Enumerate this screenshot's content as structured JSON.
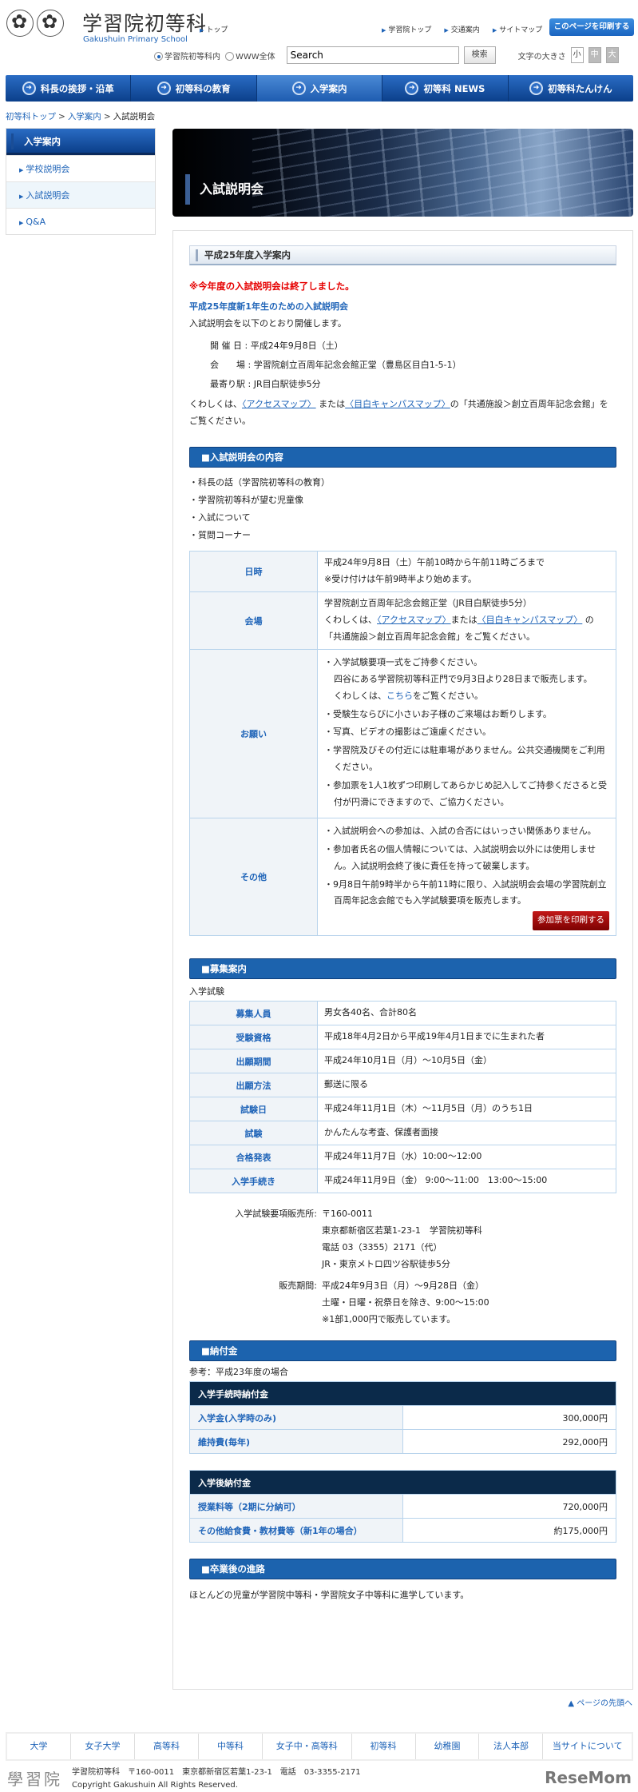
{
  "header": {
    "title": "学習院初等科",
    "subtitle": "Gakushuin Primary School",
    "top_link": "トップ",
    "util_links": [
      "学習院トップ",
      "交通案内",
      "サイトマップ"
    ],
    "print_label": "このページを印刷する",
    "search": {
      "scope_options": [
        "学習院初等科内",
        "WWW全体"
      ],
      "value": "Search",
      "button": "検索"
    },
    "font_size": {
      "label": "文字の大きさ",
      "options": [
        "小",
        "中",
        "大"
      ]
    }
  },
  "nav": [
    "科長の挨拶・沿革",
    "初等科の教育",
    "入学案内",
    "初等科 NEWS",
    "初等科たんけん"
  ],
  "breadcrumb": [
    "初等科トップ",
    "入学案内",
    "入試説明会"
  ],
  "sidebar": {
    "heading": "入学案内",
    "items": [
      "学校説明会",
      "入試説明会",
      "Q&A"
    ]
  },
  "hero_title": "入試説明会",
  "intro": {
    "heading": "平成25年度入学案内",
    "notice": "※今年度の入試説明会は終了しました。",
    "subtitle": "平成25年度新1年生のための入試説明会",
    "lead": "入試説明会を以下のとおり開催します。",
    "info": [
      "開 催 日 : 平成24年9月8日（土）",
      "会　　場 : 学習院創立百周年記念会館正堂（豊島区目白1-5-1）",
      "最寄り駅 : JR目白駅徒歩5分"
    ],
    "detail_pre": "くわしくは、",
    "link1": "〈アクセスマップ〉",
    "mid": " または",
    "link2": "〈目白キャンパスマップ〉",
    "detail_post": "の「共通施設＞創立百周年記念会館」をご覧ください。"
  },
  "content": {
    "heading": "■入試説明会の内容",
    "items": [
      "科長の話（学習院初等科の教育）",
      "学習院初等科が望む児童像",
      "入試について",
      "質問コーナー"
    ],
    "table": {
      "date_label": "日時",
      "date_lines": [
        "平成24年9月8日（土）午前10時から午前11時ごろまで",
        "※受け付けは午前9時半より始めます。"
      ],
      "venue_label": "会場",
      "venue_line": "学習院創立百周年記念会館正堂（JR目白駅徒歩5分）",
      "venue_pre": "くわしくは、",
      "venue_link1": "〈アクセスマップ〉",
      "venue_mid": "または",
      "venue_link2": "〈目白キャンパスマップ〉",
      "venue_post": " の「共通施設＞創立百周年記念会館」をご覧ください。",
      "request_label": "お願い",
      "request_first": "入学試験要項一式をご持参ください。",
      "request_first_2": "四谷にある学習院初等科正門で9月3日より28日まで販売します。",
      "request_first_pre": "くわしくは、",
      "request_first_link": "こちら",
      "request_first_post": "をご覧ください。",
      "requests": [
        "受験生ならびに小さいお子様のご来場はお断りします。",
        "写真、ビデオの撮影はご遠慮ください。",
        "学習院及びその付近には駐車場がありません。公共交通機関をご利用ください。",
        "参加票を1人1枚ずつ印刷してあらかじめ記入してご持参くださると受付が円滑にできますので、ご協力ください。"
      ],
      "other_label": "その他",
      "others": [
        "入試説明会への参加は、入試の合否にはいっさい関係ありません。",
        "参加者氏名の個人情報については、入試説明会以外には使用しません。入試説明会終了後に責任を持って破棄します。",
        "9月8日午前9時半から午前11時に限り、入試説明会会場の学習院創立百周年記念会館でも入学試験要項を販売します。"
      ],
      "print_ticket": "参加票を印刷する"
    }
  },
  "recruit": {
    "heading": "■募集案内",
    "label": "入学試験",
    "rows": [
      {
        "k": "募集人員",
        "v": "男女各40名、合計80名"
      },
      {
        "k": "受験資格",
        "v": "平成18年4月2日から平成19年4月1日までに生まれた者"
      },
      {
        "k": "出願期間",
        "v": "平成24年10月1日（月）～10月5日（金）"
      },
      {
        "k": "出願方法",
        "v": "郵送に限る"
      },
      {
        "k": "試験日",
        "v": "平成24年11月1日（木）～11月5日（月）のうち1日"
      },
      {
        "k": "試験",
        "v": "かんたんな考査、保護者面接"
      },
      {
        "k": "合格発表",
        "v": "平成24年11月7日（水）10:00～12:00"
      },
      {
        "k": "入学手続き",
        "v": "平成24年11月9日（金） 9:00～11:00　13:00～15:00"
      }
    ],
    "sales_place_label": "入学試験要項販売所:",
    "sales_place": [
      "〒160-0011",
      "東京都新宿区若葉1-23-1　学習院初等科",
      "電話 03（3355）2171（代）",
      "JR・東京メトロ四ツ谷駅徒歩5分"
    ],
    "sales_period_label": "販売期間:",
    "sales_period": [
      "平成24年9月3日（月）～9月28日（金）",
      "土曜・日曜・祝祭日を除き、9:00～15:00",
      "※1部1,000円で販売しています。"
    ]
  },
  "fees": {
    "heading": "■納付金",
    "note": "参考：平成23年度の場合",
    "t1": {
      "title": "入学手続時納付金",
      "rows": [
        {
          "k": "入学金(入学時のみ)",
          "v": "300,000円"
        },
        {
          "k": "維持費(毎年)",
          "v": "292,000円"
        }
      ]
    },
    "t2": {
      "title": "入学後納付金",
      "rows": [
        {
          "k": "授業料等（2期に分納可）",
          "v": "720,000円"
        },
        {
          "k": "その他給食費・教材費等（新1年の場合）",
          "v": "約175,000円"
        }
      ]
    }
  },
  "after": {
    "heading": "■卒業後の進路",
    "text": "ほとんどの児童が学習院中等科・学習院女子中等科に進学しています。"
  },
  "page_top": "▲ ページの先頭へ",
  "footer": {
    "links": [
      "大学",
      "女子大学",
      "高等科",
      "中等科",
      "女子中・高等科",
      "初等科",
      "幼稚園",
      "法人本部",
      "当サイトについて"
    ],
    "logo": "學習院",
    "address": "学習院初等科　〒160-0011　東京都新宿区若葉1-23-1　電話　03-3355-2171",
    "copyright": "Copyright Gakushuin All Rights Reserved.",
    "watermark": "ReseMom"
  }
}
